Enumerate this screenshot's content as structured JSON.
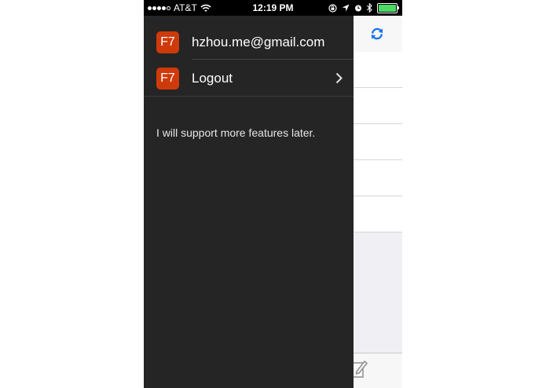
{
  "status_bar": {
    "carrier": "AT&T",
    "time": "12:19 PM",
    "battery_color": "#4cd964"
  },
  "drawer": {
    "items": [
      {
        "badge": "F7",
        "label": "hzhou.me@gmail.com"
      },
      {
        "badge": "F7",
        "label": "Logout"
      }
    ],
    "note": "I will support more features later."
  },
  "background_app": {
    "refresh_icon": "refresh-icon",
    "compose_icon": "compose-icon",
    "accent": "#1a73e8"
  }
}
